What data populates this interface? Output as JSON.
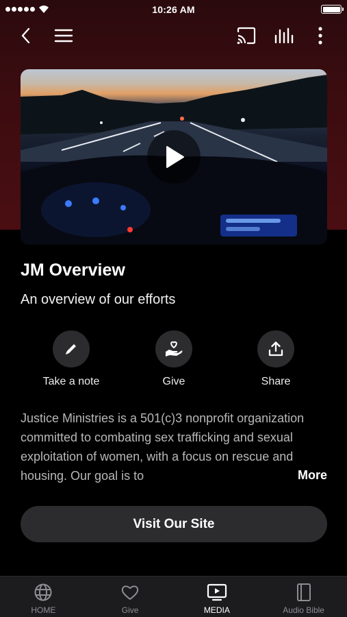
{
  "status_bar": {
    "time": "10:26 AM"
  },
  "nav": {
    "back_icon": "chevron-left-icon",
    "menu_icon": "hamburger-icon",
    "cast_icon": "cast-icon",
    "audio_icon": "equalizer-bars-icon",
    "more_icon": "vertical-ellipsis-icon"
  },
  "video": {
    "play_icon": "play-icon"
  },
  "content": {
    "title": "JM Overview",
    "subtitle": "An overview of our efforts",
    "description": "Justice Ministries is a 501(c)3 nonprofit organization committed to combating sex trafficking and sexual exploitation of women, with a focus on rescue and housing. Our goal is to",
    "more_label": "More",
    "visit_label": "Visit Our Site"
  },
  "actions": [
    {
      "label": "Take a note",
      "icon": "pencil-icon"
    },
    {
      "label": "Give",
      "icon": "heart-hand-icon"
    },
    {
      "label": "Share",
      "icon": "share-upload-icon"
    }
  ],
  "tabs": [
    {
      "label": "HOME",
      "icon": "globe-icon",
      "active": false
    },
    {
      "label": "Give",
      "icon": "heart-icon",
      "active": false
    },
    {
      "label": "MEDIA",
      "icon": "tv-play-icon",
      "active": true
    },
    {
      "label": "Audio Bible",
      "icon": "book-icon",
      "active": false
    }
  ],
  "colors": {
    "hero": "#3b0c10",
    "surface": "#2c2c2e",
    "tabbar": "#1c1c1e"
  }
}
